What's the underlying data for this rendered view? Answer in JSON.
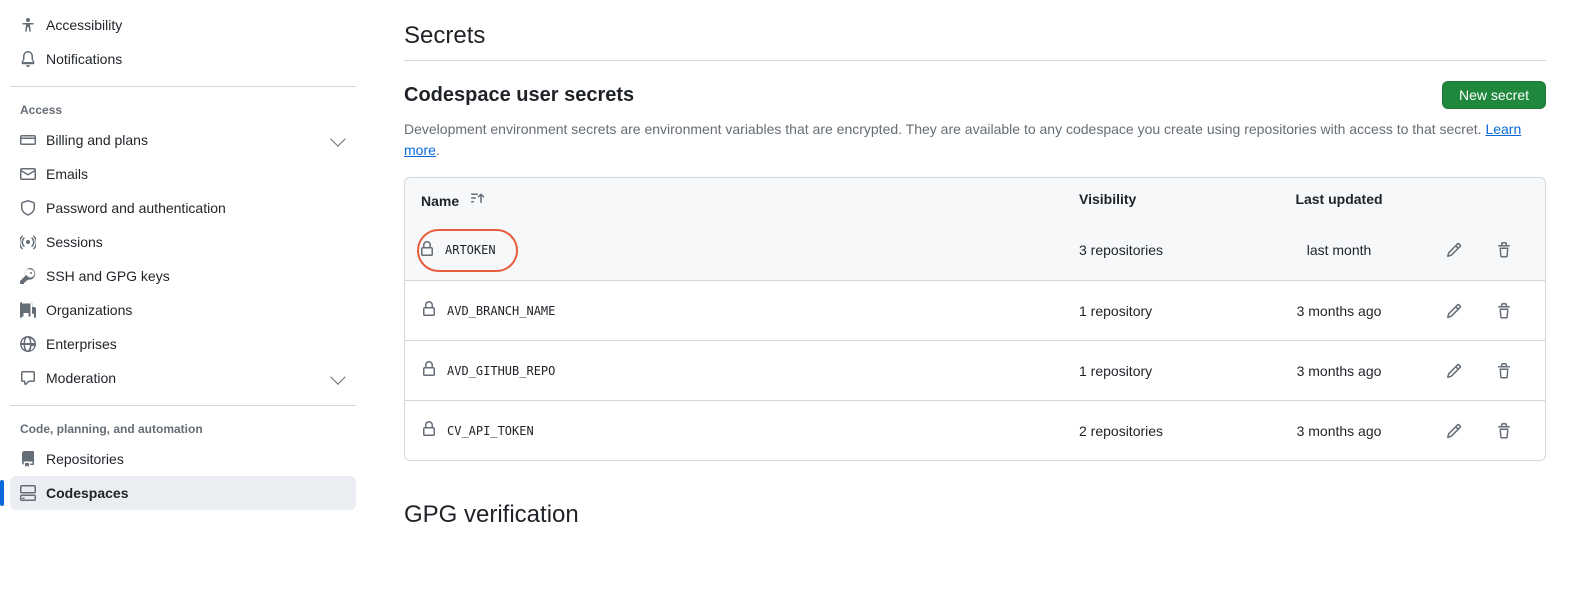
{
  "sidebar": {
    "top_items": [
      {
        "label": "Accessibility",
        "icon": "accessibility"
      },
      {
        "label": "Notifications",
        "icon": "bell"
      }
    ],
    "section_access_label": "Access",
    "access_items": [
      {
        "label": "Billing and plans",
        "icon": "card",
        "expandable": true
      },
      {
        "label": "Emails",
        "icon": "mail"
      },
      {
        "label": "Password and authentication",
        "icon": "shield"
      },
      {
        "label": "Sessions",
        "icon": "broadcast"
      },
      {
        "label": "SSH and GPG keys",
        "icon": "key"
      },
      {
        "label": "Organizations",
        "icon": "org"
      },
      {
        "label": "Enterprises",
        "icon": "globe"
      },
      {
        "label": "Moderation",
        "icon": "comment",
        "expandable": true
      }
    ],
    "section_code_label": "Code, planning, and automation",
    "code_items": [
      {
        "label": "Repositories",
        "icon": "repo"
      },
      {
        "label": "Codespaces",
        "icon": "codespaces",
        "active": true
      }
    ]
  },
  "main": {
    "page_title": "Secrets",
    "subsection_title": "Codespace user secrets",
    "new_secret_label": "New secret",
    "description_text": "Development environment secrets are environment variables that are encrypted. They are available to any codespace you create using repositories with access to that secret. ",
    "learn_more_label": "Learn more",
    "columns": {
      "name": "Name",
      "visibility": "Visibility",
      "updated": "Last updated"
    },
    "secrets": [
      {
        "name": "ARTOKEN",
        "visibility": "3 repositories",
        "updated": "last month",
        "highlight": true
      },
      {
        "name": "AVD_BRANCH_NAME",
        "visibility": "1 repository",
        "updated": "3 months ago"
      },
      {
        "name": "AVD_GITHUB_REPO",
        "visibility": "1 repository",
        "updated": "3 months ago"
      },
      {
        "name": "CV_API_TOKEN",
        "visibility": "2 repositories",
        "updated": "3 months ago"
      }
    ],
    "gpg_heading": "GPG verification"
  }
}
